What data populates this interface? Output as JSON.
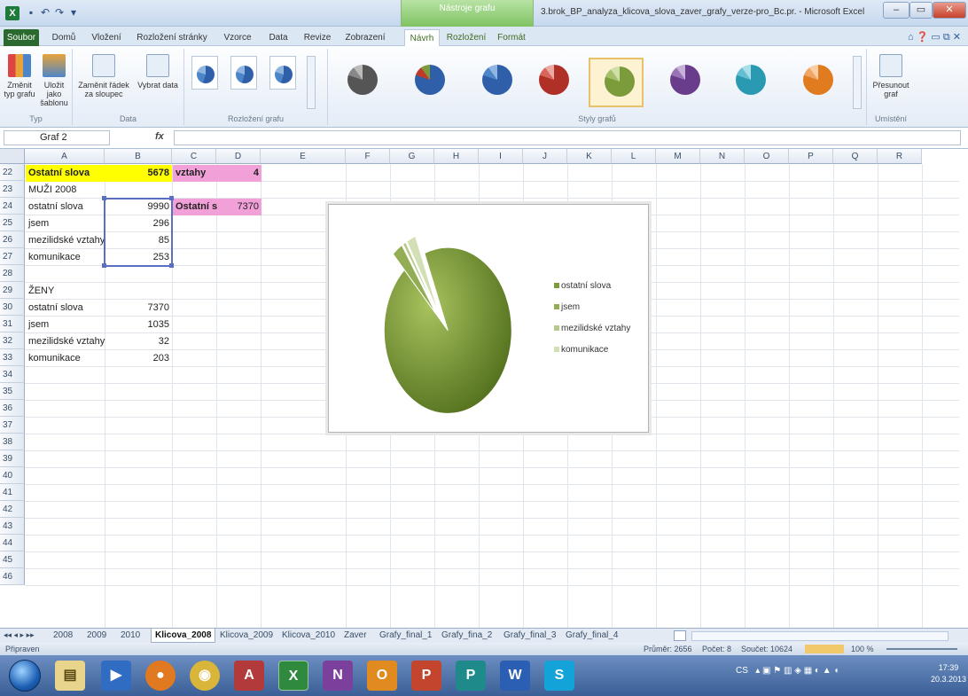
{
  "window": {
    "ctx_title": "Nástroje grafu",
    "doc_title": "3.brok_BP_analyza_klicova_slova_zaver_grafy_verze-pro_Bc.pr. - Microsoft Excel"
  },
  "tabs": [
    {
      "label": "Soubor"
    },
    {
      "label": "Domů"
    },
    {
      "label": "Vložení"
    },
    {
      "label": "Rozložení stránky"
    },
    {
      "label": "Vzorce"
    },
    {
      "label": "Data"
    },
    {
      "label": "Revize"
    },
    {
      "label": "Zobrazení"
    },
    {
      "label": "Návrh"
    },
    {
      "label": "Rozložení"
    },
    {
      "label": "Formát"
    }
  ],
  "ribbon": {
    "change_type": "Změnit typ grafu",
    "save_template": "Uložit jako šablonu",
    "group_type": "Typ",
    "switch_rowcol": "Zaměnit řádek za sloupec",
    "select_data": "Vybrat data",
    "group_data": "Data",
    "group_layouts": "Rozložení grafu",
    "group_styles": "Styly grafů",
    "move_chart": "Přesunout graf",
    "group_location": "Umístění"
  },
  "formula_bar": {
    "name_box": "Graf 2",
    "fx": "fx",
    "value": ""
  },
  "columns": [
    "A",
    "B",
    "C",
    "D",
    "E",
    "F",
    "G",
    "H",
    "I",
    "J",
    "K",
    "L",
    "M",
    "N",
    "O",
    "P",
    "Q",
    "R"
  ],
  "rows": [
    "22",
    "23",
    "24",
    "25",
    "26",
    "27",
    "28",
    "29",
    "30",
    "31",
    "32",
    "33",
    "34",
    "35",
    "36",
    "37",
    "38",
    "39",
    "40",
    "41",
    "42",
    "43",
    "44",
    "45",
    "46"
  ],
  "cells": {
    "a22": "Ostatní slova",
    "b22": "5678",
    "c22": "vztahy",
    "d22": "4",
    "a23": "MUŽI 2008",
    "a24": "ostatní slova",
    "b24": "9990",
    "c24": "Ostatní sl",
    "d24": "7370",
    "a25": "jsem",
    "b25": "296",
    "a26": "mezilidské vztahy",
    "b26": "85",
    "a27": "komunikace",
    "b27": "253",
    "a29": "ŽENY",
    "a30": "ostatní slova",
    "b30": "7370",
    "a31": "jsem",
    "b31": "1035",
    "a32": "mezilidské vztahy",
    "b32": "32",
    "a33": "komunikace",
    "b33": "203"
  },
  "colors": {
    "yellow_fill": "#ffff00",
    "pink_fill": "#f2a0d8",
    "pie_green": "#7c9b3a",
    "pie_green_dark": "#56731f"
  },
  "chart_data": {
    "type": "pie",
    "title": "",
    "categories": [
      "ostatní slova",
      "jsem",
      "mezilidské vztahy",
      "komunikace"
    ],
    "values": [
      9990,
      296,
      85,
      253
    ],
    "exploded": true,
    "legend_position": "right"
  },
  "sheets": [
    "2008",
    "2009",
    "2010",
    "Klicova_2008",
    "Klicova_2009",
    "Klicova_2010",
    "Zaver",
    "Grafy_final_1",
    "Grafy_fina_2",
    "Grafy_final_3",
    "Grafy_final_4"
  ],
  "active_sheet": "Klicova_2008",
  "status": {
    "ready": "Připraven",
    "average": "Průměr: 2656",
    "count": "Počet: 8",
    "sum": "Součet: 10624",
    "zoom": "100 %"
  },
  "taskbar": {
    "lang": "CS",
    "time": "17:39",
    "date": "20.3.2013"
  }
}
